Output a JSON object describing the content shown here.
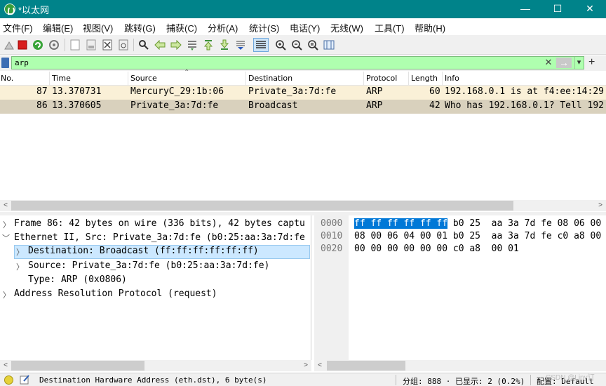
{
  "window": {
    "title": "*以太网",
    "minimize": "—",
    "maximize": "☐",
    "close": "✕"
  },
  "menu": [
    "文件(F)",
    "编辑(E)",
    "视图(V)",
    "跳转(G)",
    "捕获(C)",
    "分析(A)",
    "统计(S)",
    "电话(Y)",
    "无线(W)",
    "工具(T)",
    "帮助(H)"
  ],
  "filter": {
    "value": "arp",
    "clear_icon": "✕",
    "apply_icon": "→",
    "dropdown_icon": "▾",
    "add_icon": "+"
  },
  "packet_list": {
    "columns": [
      "No.",
      "Time",
      "Source",
      "Destination",
      "Protocol",
      "Length",
      "Info"
    ],
    "rows": [
      {
        "no": "87",
        "time": "13.370731",
        "source": "MercuryC_29:1b:06",
        "destination": "Private_3a:7d:fe",
        "protocol": "ARP",
        "length": "60",
        "info": "192.168.0.1 is at f4:ee:14:29:"
      },
      {
        "no": "86",
        "time": "13.370605",
        "source": "Private_3a:7d:fe",
        "destination": "Broadcast",
        "protocol": "ARP",
        "length": "42",
        "info": "Who has 192.168.0.1? Tell 192"
      }
    ],
    "row_colors": {
      "row0": "#faf0d7",
      "row1": "#d9d1bd"
    }
  },
  "details": [
    "Frame 86: 42 bytes on wire (336 bits), 42 bytes captu",
    "Ethernet II, Src: Private_3a:7d:fe (b0:25:aa:3a:7d:fe",
    "Destination: Broadcast (ff:ff:ff:ff:ff:ff)",
    "Source: Private_3a:7d:fe (b0:25:aa:3a:7d:fe)",
    "Type: ARP (0x0806)",
    "Address Resolution Protocol (request)"
  ],
  "hex": {
    "offsets": [
      "0000",
      "0010",
      "0020"
    ],
    "line0_sel": "ff ff ff ff ff ff",
    "line0_rest": " b0 25  aa 3a 7d fe 08 06 00",
    "line1": "08 00 06 04 00 01 b0 25  aa 3a 7d fe c0 a8 00",
    "line2": "00 00 00 00 00 00 c0 a8  00 01"
  },
  "status": {
    "field": "Destination Hardware Address (eth.dst), 6 byte(s)",
    "packets": "分组: 888 · 已显示: 2 (0.2%)",
    "profile": "配置: Default",
    "watermark": "CSDN @Liny订"
  },
  "colors": {
    "titlebar": "#00838a",
    "filter_ok": "#afffaf",
    "selection": "#cce8ff",
    "hex_sel": "#0078d7"
  }
}
